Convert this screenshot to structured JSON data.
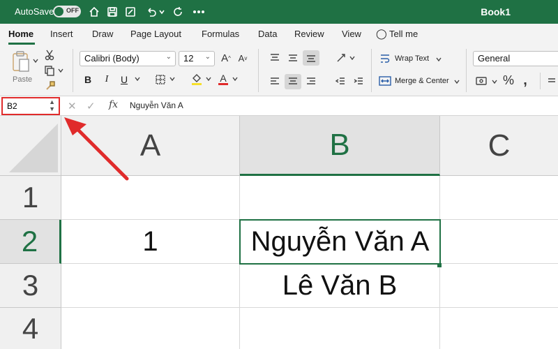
{
  "titlebar": {
    "autosave_label": "AutoSave",
    "toggle_state": "OFF",
    "book_title": "Book1",
    "icons": [
      "home-icon",
      "save-icon",
      "edit-icon",
      "undo-icon",
      "redo-icon",
      "more-icon"
    ]
  },
  "ribbon_tabs": [
    {
      "label": "Home",
      "active": true
    },
    {
      "label": "Insert"
    },
    {
      "label": "Draw"
    },
    {
      "label": "Page Layout"
    },
    {
      "label": "Formulas"
    },
    {
      "label": "Data"
    },
    {
      "label": "Review"
    },
    {
      "label": "View"
    },
    {
      "label": "Tell me"
    }
  ],
  "ribbon": {
    "paste_label": "Paste",
    "font_name": "Calibri (Body)",
    "font_size": "12",
    "bold": "B",
    "italic": "I",
    "underline": "U",
    "wrap_text": "Wrap Text",
    "merge_center": "Merge & Center",
    "number_format": "General"
  },
  "formula_bar": {
    "name_box": "B2",
    "fx": "fx",
    "value": "Nguyễn Văn A"
  },
  "sheet": {
    "columns": [
      "A",
      "B",
      "C"
    ],
    "rows": [
      "1",
      "2",
      "3",
      "4"
    ],
    "cells": {
      "A2": "1",
      "B2": "Nguyễn Văn A",
      "B3": "Lê Văn B"
    },
    "selected_cell": "B2"
  },
  "colors": {
    "accent": "#1f7144",
    "annotation": "#e02b2b"
  }
}
